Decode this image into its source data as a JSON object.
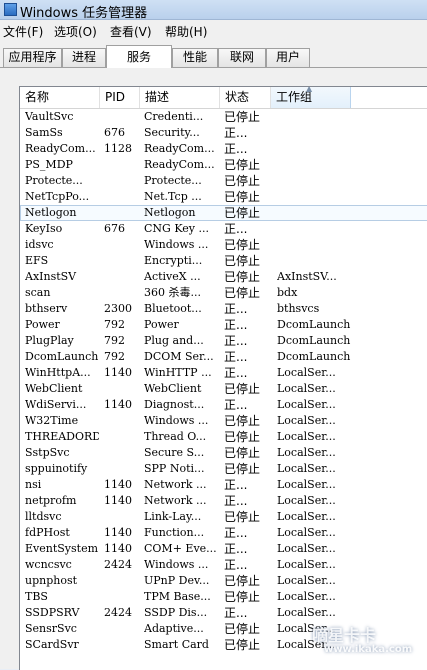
{
  "window": {
    "title": "Windows 任务管理器"
  },
  "menu": [
    "文件(F)",
    "选项(O)",
    "查看(V)",
    "帮助(H)"
  ],
  "tabs": [
    "应用程序",
    "进程",
    "服务",
    "性能",
    "联网",
    "用户"
  ],
  "active_tab": "服务",
  "columns": {
    "name": "名称",
    "pid": "PID",
    "desc": "描述",
    "status": "状态",
    "group": "工作组"
  },
  "rows": [
    {
      "name": "VaultSvc",
      "pid": "",
      "desc": "Credenti...",
      "status": "已停止",
      "group": ""
    },
    {
      "name": "SamSs",
      "pid": "676",
      "desc": "Security...",
      "status": "正...",
      "group": ""
    },
    {
      "name": "ReadyCom...",
      "pid": "1128",
      "desc": "ReadyCom...",
      "status": "正...",
      "group": ""
    },
    {
      "name": "PS_MDP",
      "pid": "",
      "desc": "ReadyCom...",
      "status": "已停止",
      "group": ""
    },
    {
      "name": "Protecte...",
      "pid": "",
      "desc": "Protecte...",
      "status": "已停止",
      "group": ""
    },
    {
      "name": "NetTcpPo...",
      "pid": "",
      "desc": "Net.Tcp ...",
      "status": "已停止",
      "group": ""
    },
    {
      "name": "Netlogon",
      "pid": "",
      "desc": "Netlogon",
      "status": "已停止",
      "group": "",
      "selected": true
    },
    {
      "name": "KeyIso",
      "pid": "676",
      "desc": "CNG Key ...",
      "status": "正...",
      "group": ""
    },
    {
      "name": "idsvc",
      "pid": "",
      "desc": "Windows ...",
      "status": "已停止",
      "group": ""
    },
    {
      "name": "EFS",
      "pid": "",
      "desc": "Encrypti...",
      "status": "已停止",
      "group": ""
    },
    {
      "name": "AxInstSV",
      "pid": "",
      "desc": "ActiveX ...",
      "status": "已停止",
      "group": "AxInstSV..."
    },
    {
      "name": "scan",
      "pid": "",
      "desc": "360 杀毒...",
      "status": "已停止",
      "group": "bdx"
    },
    {
      "name": "bthserv",
      "pid": "2300",
      "desc": "Bluetoot...",
      "status": "正...",
      "group": "bthsvcs"
    },
    {
      "name": "Power",
      "pid": "792",
      "desc": "Power",
      "status": "正...",
      "group": "DcomLaunch"
    },
    {
      "name": "PlugPlay",
      "pid": "792",
      "desc": "Plug and...",
      "status": "正...",
      "group": "DcomLaunch"
    },
    {
      "name": "DcomLaunch",
      "pid": "792",
      "desc": "DCOM Ser...",
      "status": "正...",
      "group": "DcomLaunch"
    },
    {
      "name": "WinHttpA...",
      "pid": "1140",
      "desc": "WinHTTP ...",
      "status": "正...",
      "group": "LocalSer..."
    },
    {
      "name": "WebClient",
      "pid": "",
      "desc": "WebClient",
      "status": "已停止",
      "group": "LocalSer..."
    },
    {
      "name": "WdiServi...",
      "pid": "1140",
      "desc": "Diagnost...",
      "status": "正...",
      "group": "LocalSer..."
    },
    {
      "name": "W32Time",
      "pid": "",
      "desc": "Windows ...",
      "status": "已停止",
      "group": "LocalSer..."
    },
    {
      "name": "THREADORDER",
      "pid": "",
      "desc": "Thread O...",
      "status": "已停止",
      "group": "LocalSer..."
    },
    {
      "name": "SstpSvc",
      "pid": "",
      "desc": "Secure S...",
      "status": "已停止",
      "group": "LocalSer..."
    },
    {
      "name": "sppuinotify",
      "pid": "",
      "desc": "SPP Noti...",
      "status": "已停止",
      "group": "LocalSer..."
    },
    {
      "name": "nsi",
      "pid": "1140",
      "desc": "Network ...",
      "status": "正...",
      "group": "LocalSer..."
    },
    {
      "name": "netprofm",
      "pid": "1140",
      "desc": "Network ...",
      "status": "正...",
      "group": "LocalSer..."
    },
    {
      "name": "lltdsvc",
      "pid": "",
      "desc": "Link-Lay...",
      "status": "已停止",
      "group": "LocalSer..."
    },
    {
      "name": "fdPHost",
      "pid": "1140",
      "desc": "Function...",
      "status": "正...",
      "group": "LocalSer..."
    },
    {
      "name": "EventSystem",
      "pid": "1140",
      "desc": "COM+ Eve...",
      "status": "正...",
      "group": "LocalSer..."
    },
    {
      "name": "wcncsvc",
      "pid": "2424",
      "desc": "Windows ...",
      "status": "正...",
      "group": "LocalSer..."
    },
    {
      "name": "upnphost",
      "pid": "",
      "desc": "UPnP Dev...",
      "status": "已停止",
      "group": "LocalSer..."
    },
    {
      "name": "TBS",
      "pid": "",
      "desc": "TPM Base...",
      "status": "已停止",
      "group": "LocalSer..."
    },
    {
      "name": "SSDPSRV",
      "pid": "2424",
      "desc": "SSDP Dis...",
      "status": "正...",
      "group": "LocalSer..."
    },
    {
      "name": "SensrSvc",
      "pid": "",
      "desc": "Adaptive...",
      "status": "已停止",
      "group": "LocalSer..."
    },
    {
      "name": "SCardSvr",
      "pid": "",
      "desc": "Smart Card",
      "status": "已停止",
      "group": "LocalSer..."
    }
  ],
  "watermark": {
    "logo": "嘀星卡卡",
    "url": "www.ikaka.com"
  }
}
